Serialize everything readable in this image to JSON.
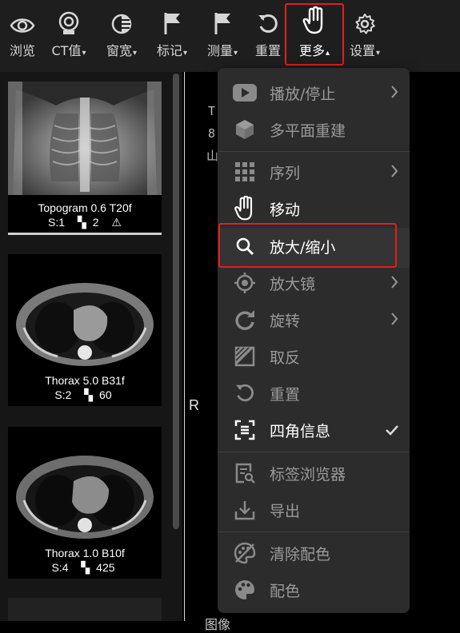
{
  "toolbar": {
    "items": [
      {
        "key": "browse",
        "label": "浏览",
        "icon": "eye-icon"
      },
      {
        "key": "ct",
        "label": "CT值",
        "icon": "ct-value-icon",
        "dropdown": true
      },
      {
        "key": "window",
        "label": "窗宽",
        "icon": "window-level-icon",
        "dropdown": true
      },
      {
        "key": "mark",
        "label": "标记",
        "icon": "flag-icon",
        "dropdown": true
      },
      {
        "key": "measure",
        "label": "测量",
        "icon": "measure-flag-icon",
        "dropdown": true
      },
      {
        "key": "reset",
        "label": "重置",
        "icon": "reset-icon"
      },
      {
        "key": "more",
        "label": "更多",
        "icon": "hand-icon",
        "dropdown": true,
        "active": true
      },
      {
        "key": "settings",
        "label": "设置",
        "icon": "gear-icon",
        "dropdown": true
      }
    ],
    "caret_down": "▾",
    "caret_up": "▴"
  },
  "series": [
    {
      "name": "Topogram 0.6 T20f",
      "series_num": "S:1",
      "image_count": "2",
      "warning": true
    },
    {
      "name": "Thorax 5.0 B31f",
      "series_num": "S:2",
      "image_count": "60",
      "warning": false
    },
    {
      "name": "Thorax 1.0 B10f",
      "series_num": "S:4",
      "image_count": "425",
      "warning": false
    }
  ],
  "viewer": {
    "overlay_lines": [
      "T",
      "8",
      "山"
    ],
    "orientation_marker": "R",
    "bottom_text": "图像"
  },
  "menu": {
    "items": [
      {
        "key": "play",
        "label": "播放/停止",
        "icon": "play-icon",
        "submenu": true,
        "bright": false
      },
      {
        "key": "mpr",
        "label": "多平面重建",
        "icon": "cube-icon",
        "submenu": false,
        "bright": false
      },
      {
        "key": "sequence",
        "label": "序列",
        "icon": "grid-icon",
        "submenu": true,
        "bright": false
      },
      {
        "key": "move",
        "label": "移动",
        "icon": "hand-move-icon",
        "submenu": false,
        "bright": true
      },
      {
        "key": "zoom",
        "label": "放大/缩小",
        "icon": "search-icon",
        "submenu": false,
        "bright": true,
        "highlighted": true
      },
      {
        "key": "magnifier",
        "label": "放大镜",
        "icon": "crosshair-icon",
        "submenu": true,
        "bright": false
      },
      {
        "key": "rotate",
        "label": "旋转",
        "icon": "rotate-icon",
        "submenu": true,
        "bright": false
      },
      {
        "key": "invert",
        "label": "取反",
        "icon": "invert-icon",
        "submenu": false,
        "bright": false
      },
      {
        "key": "reset",
        "label": "重置",
        "icon": "reset-icon",
        "submenu": false,
        "bright": false
      },
      {
        "key": "corner_info",
        "label": "四角信息",
        "icon": "corner-info-icon",
        "submenu": false,
        "bright": true,
        "checked": true
      },
      {
        "key": "tag_browser",
        "label": "标签浏览器",
        "icon": "tag-browser-icon",
        "submenu": false,
        "bright": false
      },
      {
        "key": "export",
        "label": "导出",
        "icon": "export-icon",
        "submenu": false,
        "bright": false
      },
      {
        "key": "clear_color",
        "label": "清除配色",
        "icon": "clear-palette-icon",
        "submenu": false,
        "bright": false
      },
      {
        "key": "color",
        "label": "配色",
        "icon": "palette-icon",
        "submenu": false,
        "bright": false
      }
    ],
    "submenu_arrow": "›",
    "check_mark": "✔"
  },
  "colors": {
    "highlight": "#e02020",
    "menu_bg": "#2c2c2c",
    "toolbar_bg": "#1e1e1e"
  }
}
